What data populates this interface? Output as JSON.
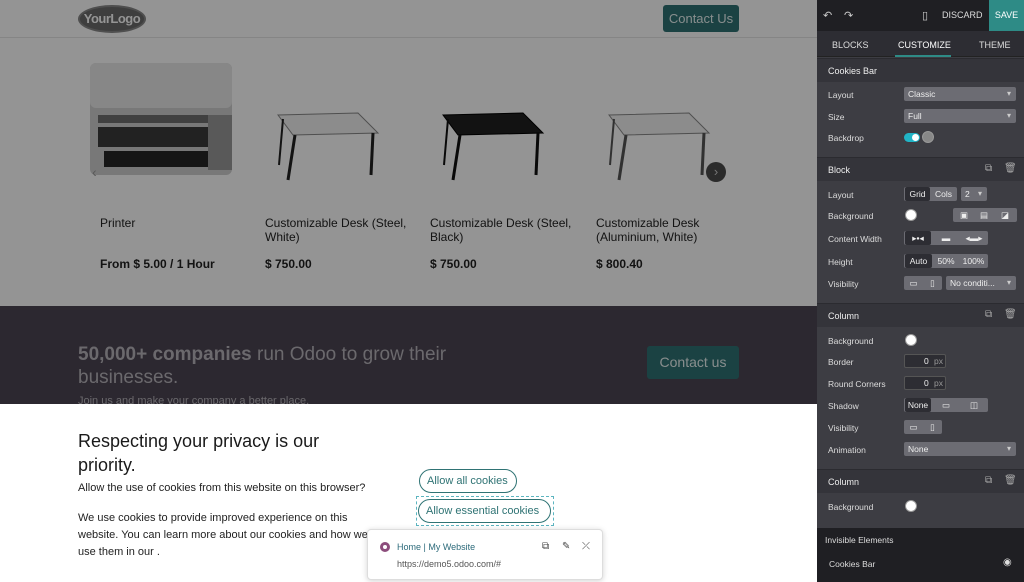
{
  "site": {
    "logo": "YourLogo",
    "header_cta": "Contact Us",
    "products": [
      {
        "name": "Printer",
        "price": "From $ 5.00 / 1 Hour"
      },
      {
        "name": "Customizable Desk (Steel, White)",
        "price": "$ 750.00"
      },
      {
        "name": "Customizable Desk (Steel, Black)",
        "price": "$ 750.00"
      },
      {
        "name": "Customizable Desk (Aluminium, White)",
        "price": "$ 800.40"
      }
    ],
    "band": {
      "headline_bold": "50,000+ companies",
      "headline_rest": " run Odoo to grow their businesses.",
      "sub": "Join us and make your company a better place.",
      "cta": "Contact us"
    },
    "cookies": {
      "title": "Respecting your privacy is our priority.",
      "question": "Allow the use of cookies from this website on this browser?",
      "desc": "We use cookies to provide improved experience on this website. You can learn more about our cookies and how we use them in our .",
      "allow_all": "Allow all cookies",
      "allow_essential": "Allow essential cookies"
    },
    "popover": {
      "title": "Home | My Website",
      "url": "https://demo5.odoo.com/#"
    }
  },
  "panel": {
    "discard": "DISCARD",
    "save": "SAVE",
    "tabs": [
      "BLOCKS",
      "CUSTOMIZE",
      "THEME"
    ],
    "cookies_bar": {
      "title": "Cookies Bar",
      "layout_label": "Layout",
      "layout_value": "Classic",
      "size_label": "Size",
      "size_value": "Full",
      "backdrop_label": "Backdrop"
    },
    "block": {
      "title": "Block",
      "layout_label": "Layout",
      "grid": "Grid",
      "cols": "Cols",
      "cols_n": "2",
      "background_label": "Background",
      "content_width_label": "Content Width",
      "height_label": "Height",
      "h_auto": "Auto",
      "h_50": "50%",
      "h_100": "100%",
      "visibility_label": "Visibility",
      "visibility_value": "No conditi..."
    },
    "column1": {
      "title": "Column",
      "background_label": "Background",
      "border_label": "Border",
      "border_value": "0",
      "border_unit": "px",
      "corners_label": "Round Corners",
      "corners_value": "0",
      "corners_unit": "px",
      "shadow_label": "Shadow",
      "shadow_none": "None",
      "visibility_label": "Visibility",
      "animation_label": "Animation",
      "animation_value": "None"
    },
    "column2": {
      "title": "Column",
      "background_label": "Background"
    },
    "invisible": {
      "title": "Invisible Elements",
      "item": "Cookies Bar"
    },
    "accent": "#2e8b86"
  }
}
